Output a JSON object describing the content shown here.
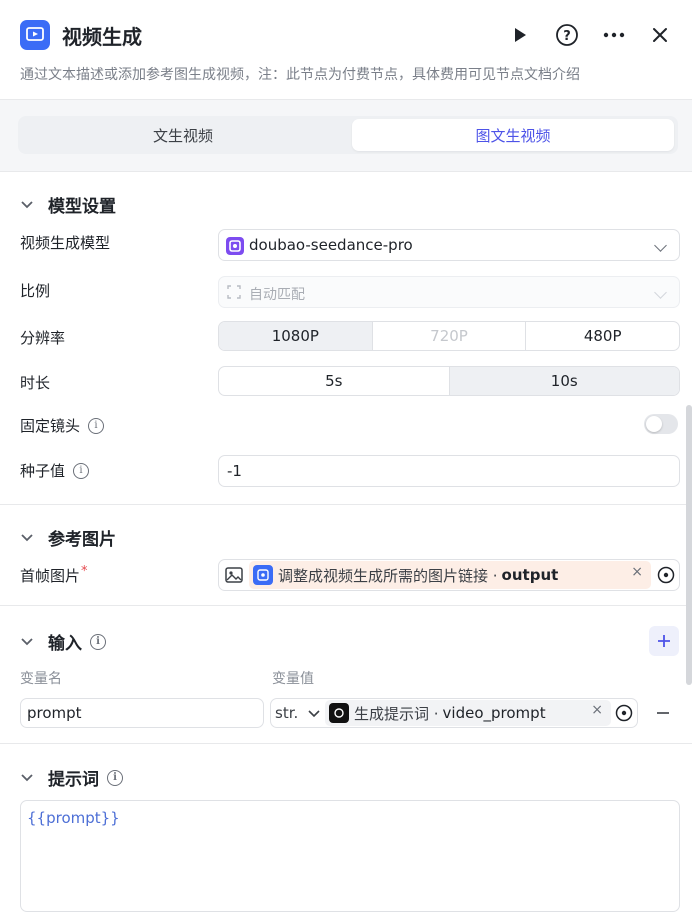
{
  "header": {
    "title": "视频生成",
    "description": "通过文本描述或添加参考图生成视频，注：此节点为付费节点，具体费用可见节点文档介绍",
    "run_icon": "play-icon",
    "help_icon": "help-icon",
    "more_icon": "more-icon",
    "close_icon": "close-icon"
  },
  "tabs": [
    {
      "label": "文生视频",
      "active": false
    },
    {
      "label": "图文生视频",
      "active": true
    }
  ],
  "model_settings": {
    "title": "模型设置",
    "model_label": "视频生成模型",
    "model_value": "doubao-seedance-pro",
    "ratio_label": "比例",
    "ratio_value": "自动匹配",
    "resolution_label": "分辨率",
    "resolution_options": [
      "1080P",
      "720P",
      "480P"
    ],
    "resolution_selected": "1080P",
    "duration_label": "时长",
    "duration_options": [
      "5s",
      "10s"
    ],
    "duration_selected": "10s",
    "fixed_camera_label": "固定镜头",
    "fixed_camera_on": false,
    "seed_label": "种子值",
    "seed_value": "-1"
  },
  "reference_image": {
    "title": "参考图片",
    "first_frame_label": "首帧图片",
    "required_mark": "*",
    "source_text": "调整成视频生成所需的图片链接 ·",
    "source_field": "output"
  },
  "inputs": {
    "title": "输入",
    "col_name": "变量名",
    "col_value": "变量值",
    "rows": [
      {
        "name": "prompt",
        "type": "str.",
        "source_text": "生成提示词 ·",
        "source_field": "video_prompt"
      }
    ]
  },
  "prompt_section": {
    "title": "提示词",
    "value": "{{prompt}}"
  },
  "colors": {
    "accent": "#4d53e8",
    "brand_blue": "#3b6cf6",
    "tag_bg": "#fdeee6"
  }
}
